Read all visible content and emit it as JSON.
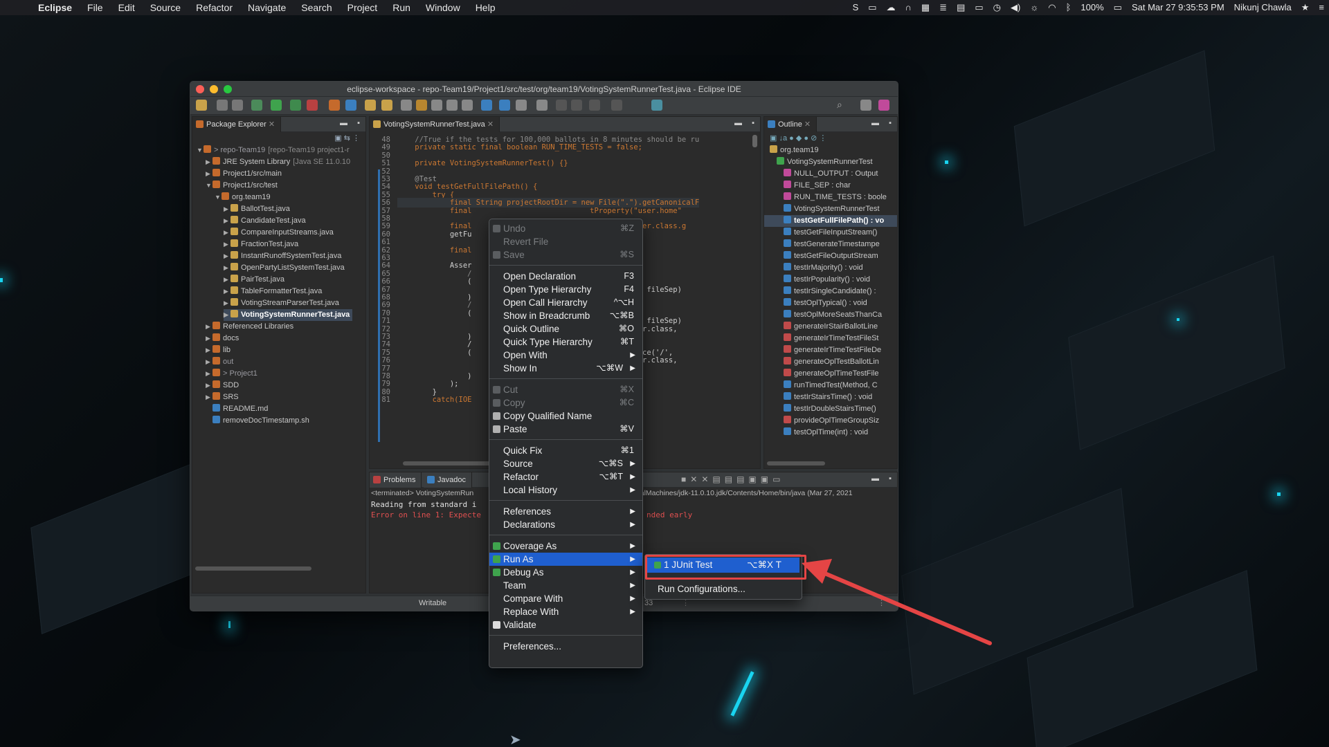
{
  "menubar": {
    "app": "Eclipse",
    "items": [
      "File",
      "Edit",
      "Source",
      "Refactor",
      "Navigate",
      "Search",
      "Project",
      "Run",
      "Window",
      "Help"
    ],
    "battery": "100%",
    "datetime": "Sat Mar 27  9:35:53 PM",
    "user": "Nikunj Chawla"
  },
  "window": {
    "title": "eclipse-workspace - repo-Team19/Project1/src/test/org/team19/VotingSystemRunnerTest.java - Eclipse IDE"
  },
  "package_explorer": {
    "tab": "Package Explorer",
    "rows": [
      {
        "label": "> repo-Team19",
        "extra": "[repo-Team19 project1-r",
        "indent": 0,
        "open": true
      },
      {
        "label": "JRE System Library",
        "extra": "[Java SE 11.0.10",
        "indent": 1,
        "open": false
      },
      {
        "label": "Project1/src/main",
        "extra": "",
        "indent": 1,
        "open": false
      },
      {
        "label": "Project1/src/test",
        "extra": "",
        "indent": 1,
        "open": true
      },
      {
        "label": "org.team19",
        "extra": "",
        "indent": 2,
        "open": true
      },
      {
        "label": "BallotTest.java",
        "extra": "",
        "indent": 3,
        "open": false
      },
      {
        "label": "CandidateTest.java",
        "extra": "",
        "indent": 3,
        "open": false
      },
      {
        "label": "CompareInputStreams.java",
        "extra": "",
        "indent": 3,
        "open": false
      },
      {
        "label": "FractionTest.java",
        "extra": "",
        "indent": 3,
        "open": false
      },
      {
        "label": "InstantRunoffSystemTest.java",
        "extra": "",
        "indent": 3,
        "open": false
      },
      {
        "label": "OpenPartyListSystemTest.java",
        "extra": "",
        "indent": 3,
        "open": false
      },
      {
        "label": "PairTest.java",
        "extra": "",
        "indent": 3,
        "open": false
      },
      {
        "label": "TableFormatterTest.java",
        "extra": "",
        "indent": 3,
        "open": false
      },
      {
        "label": "VotingStreamParserTest.java",
        "extra": "",
        "indent": 3,
        "open": false
      },
      {
        "label": "VotingSystemRunnerTest.java",
        "extra": "",
        "indent": 3,
        "open": false,
        "selected": true
      },
      {
        "label": "Referenced Libraries",
        "extra": "",
        "indent": 1,
        "open": false
      },
      {
        "label": "docs",
        "extra": "",
        "indent": 1,
        "open": false
      },
      {
        "label": "lib",
        "extra": "",
        "indent": 1,
        "open": false
      },
      {
        "label": "out",
        "extra": "",
        "indent": 1,
        "open": false
      },
      {
        "label": "> Project1",
        "extra": "",
        "indent": 1,
        "open": false
      },
      {
        "label": "SDD",
        "extra": "",
        "indent": 1,
        "open": false
      },
      {
        "label": "SRS",
        "extra": "",
        "indent": 1,
        "open": false
      },
      {
        "label": "README.md",
        "extra": "",
        "indent": 1,
        "leaf": true
      },
      {
        "label": "removeDocTimestamp.sh",
        "extra": "",
        "indent": 1,
        "leaf": true
      }
    ]
  },
  "editor": {
    "tab": "VotingSystemRunnerTest.java",
    "lines": [
      {
        "n": "48",
        "t": "    //True if the tests for 100,000 ballots in 8 minutes should be ru"
      },
      {
        "n": "49",
        "t": "    private static final boolean RUN_TIME_TESTS = false;"
      },
      {
        "n": "50",
        "t": ""
      },
      {
        "n": "51",
        "t": "    private VotingSystemRunnerTest() {}"
      },
      {
        "n": "52",
        "t": ""
      },
      {
        "n": "53",
        "t": "    @Test"
      },
      {
        "n": "54",
        "t": "    void testGetFullFilePath() {"
      },
      {
        "n": "55",
        "t": "        try {"
      },
      {
        "n": "56",
        "t": "            final String projectRootDir = new File(\".\").getCanonicalF"
      },
      {
        "n": "57",
        "t": "            final                           tProperty(\"user.home\""
      },
      {
        "n": "58",
        "t": ""
      },
      {
        "n": "59",
        "t": "            final                           ngSystemRunner.class.g"
      },
      {
        "n": "60",
        "t": "            getFu"
      },
      {
        "n": "61",
        "t": ""
      },
      {
        "n": "62",
        "t": "            final                           har;"
      },
      {
        "n": "63",
        "t": ""
      },
      {
        "n": "64",
        "t": "            Asser"
      },
      {
        "n": "65",
        "t": "                /                          t directory"
      },
      {
        "n": "66",
        "t": "                ("
      },
      {
        "n": "67",
        "t": "                                            replace('/', fileSep)"
      },
      {
        "n": "68",
        "t": "                )"
      },
      {
        "n": "69",
        "t": "                /                          directory"
      },
      {
        "n": "70",
        "t": "                ("
      },
      {
        "n": "71",
        "t": "                                            replace('/', fileSep)"
      },
      {
        "n": "72",
        "t": "                                           ngSystemRunner.class,"
      },
      {
        "n": "73",
        "t": "                )"
      },
      {
        "n": "74",
        "t": "                /"
      },
      {
        "n": "75",
        "t": "                (                          st.txt\".replace('/',"
      },
      {
        "n": "76",
        "t": "                                           ngSystemRunner.class,"
      },
      {
        "n": "77",
        "t": ""
      },
      {
        "n": "78",
        "t": "                )"
      },
      {
        "n": "79",
        "t": "            );"
      },
      {
        "n": "80",
        "t": "        }"
      },
      {
        "n": "81",
        "t": "        catch(IOE"
      }
    ]
  },
  "outline": {
    "tab": "Outline",
    "rows": [
      "org.team19",
      "VotingSystemRunnerTest",
      "NULL_OUTPUT : Output",
      "FILE_SEP : char",
      "RUN_TIME_TESTS : boole",
      "VotingSystemRunnerTest",
      "testGetFullFilePath() : vo",
      "testGetFileInputStream()",
      "testGenerateTimestampe",
      "testGetFileOutputStream",
      "testIrMajority() : void",
      "testIrPopularity() : void",
      "testIrSingleCandidate() :",
      "testOplTypical() : void",
      "testOplMoreSeatsThanCa",
      "generateIrStairBallotLine",
      "generateIrTimeTestFileSt",
      "generateIrTimeTestFileDe",
      "generateOplTestBallotLin",
      "generateOplTimeTestFile",
      "runTimedTest(Method, C",
      "testIrStairsTime() : void",
      "testIrDoubleStairsTime()",
      "provideOplTimeGroupSiz",
      "testOplTime(int) : void"
    ]
  },
  "console": {
    "tabs": [
      "Problems",
      "Javadoc"
    ],
    "terminated": "<terminated> VotingSystemRun",
    "terminated_tail": "tualMachines/jdk-11.0.10.jdk/Contents/Home/bin/java  (Mar 27, 2021",
    "line1": "Reading from standard i",
    "line2": "Error on line 1: Expecte",
    "line2_tail": "nded early"
  },
  "statusbar": {
    "writable": "Writable",
    "pos": "33"
  },
  "context_menu": [
    {
      "label": "Undo",
      "sc": "⌘Z",
      "dis": true,
      "icon": true
    },
    {
      "label": "Revert File",
      "sc": "",
      "dis": true
    },
    {
      "label": "Save",
      "sc": "⌘S",
      "dis": true,
      "icon": true
    },
    {
      "sep": true
    },
    {
      "label": "Open Declaration",
      "sc": "F3"
    },
    {
      "label": "Open Type Hierarchy",
      "sc": "F4"
    },
    {
      "label": "Open Call Hierarchy",
      "sc": "^⌥H"
    },
    {
      "label": "Show in Breadcrumb",
      "sc": "⌥⌘B"
    },
    {
      "label": "Quick Outline",
      "sc": "⌘O"
    },
    {
      "label": "Quick Type Hierarchy",
      "sc": "⌘T"
    },
    {
      "label": "Open With",
      "arrow": true
    },
    {
      "label": "Show In",
      "sc": "⌥⌘W",
      "arrow": true
    },
    {
      "sep": true
    },
    {
      "label": "Cut",
      "sc": "⌘X",
      "dis": true,
      "icon": true
    },
    {
      "label": "Copy",
      "sc": "⌘C",
      "dis": true,
      "icon": true
    },
    {
      "label": "Copy Qualified Name",
      "icon": true
    },
    {
      "label": "Paste",
      "sc": "⌘V",
      "icon": true
    },
    {
      "sep": true
    },
    {
      "label": "Quick Fix",
      "sc": "⌘1"
    },
    {
      "label": "Source",
      "sc": "⌥⌘S",
      "arrow": true
    },
    {
      "label": "Refactor",
      "sc": "⌥⌘T",
      "arrow": true
    },
    {
      "label": "Local History",
      "arrow": true
    },
    {
      "sep": true
    },
    {
      "label": "References",
      "arrow": true
    },
    {
      "label": "Declarations",
      "arrow": true
    },
    {
      "sep": true
    },
    {
      "label": "Coverage As",
      "arrow": true,
      "icon": true
    },
    {
      "label": "Run As",
      "arrow": true,
      "icon": true,
      "sel": true
    },
    {
      "label": "Debug As",
      "arrow": true,
      "icon": true
    },
    {
      "label": "Team",
      "arrow": true
    },
    {
      "label": "Compare With",
      "arrow": true
    },
    {
      "label": "Replace With",
      "arrow": true
    },
    {
      "label": "Validate",
      "icon": true
    },
    {
      "sep": true
    },
    {
      "label": "Preferences..."
    }
  ],
  "submenu": {
    "junit": "1 JUnit Test",
    "junit_sc": "⌥⌘X T",
    "run_configs": "Run Configurations..."
  },
  "colors": {
    "selection": "#1f5fcf",
    "highlight_box": "#e54545",
    "cyan_glow": "#19d4f0"
  }
}
